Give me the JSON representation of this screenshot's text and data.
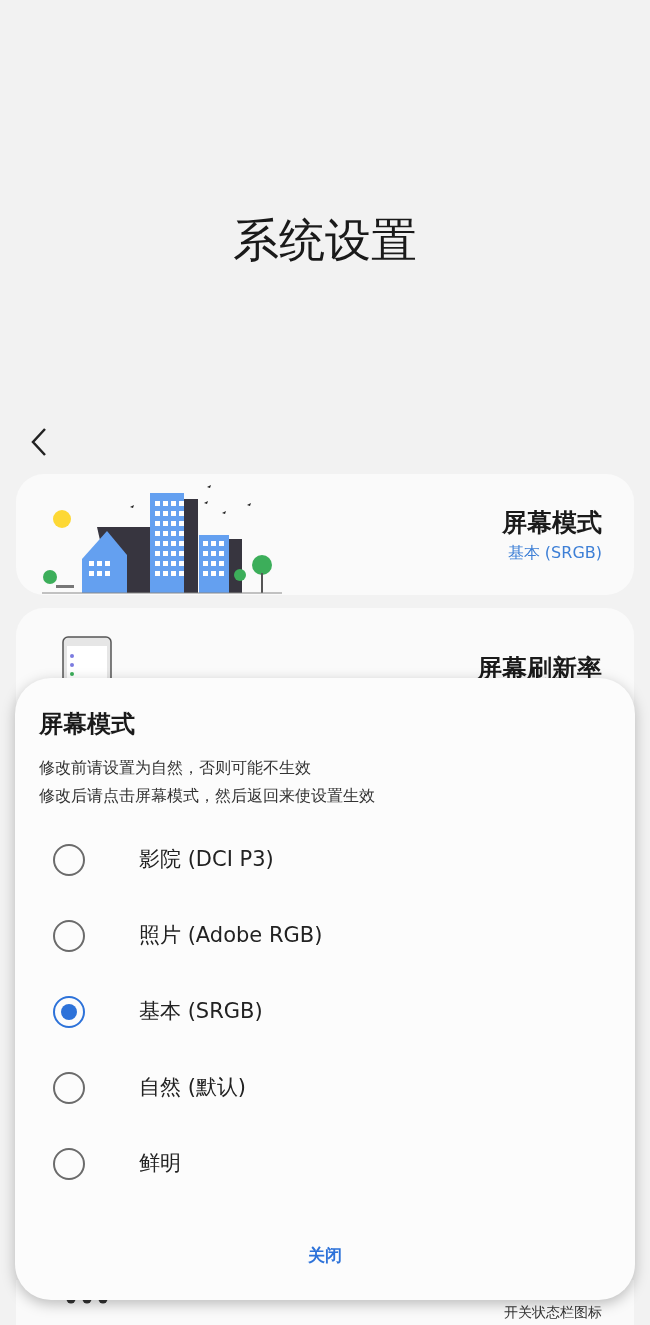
{
  "page": {
    "title": "系统设置"
  },
  "cards": [
    {
      "kind": "illustration",
      "title": "屏幕模式",
      "value": "基本 (SRGB)"
    },
    {
      "kind": "phone",
      "title": "屏幕刷新率"
    }
  ],
  "bottom_item": {
    "label": "开关状态栏图标"
  },
  "dialog": {
    "title": "屏幕模式",
    "notes": [
      "修改前请设置为自然，否则可能不生效",
      "修改后请点击屏幕模式，然后返回来使设置生效"
    ],
    "options": [
      {
        "label": "影院 (DCI P3)",
        "selected": false
      },
      {
        "label": "照片 (Adobe RGB)",
        "selected": false
      },
      {
        "label": "基本 (SRGB)",
        "selected": true
      },
      {
        "label": "自然 (默认)",
        "selected": false
      },
      {
        "label": "鲜明",
        "selected": false
      }
    ],
    "close": "关闭"
  }
}
